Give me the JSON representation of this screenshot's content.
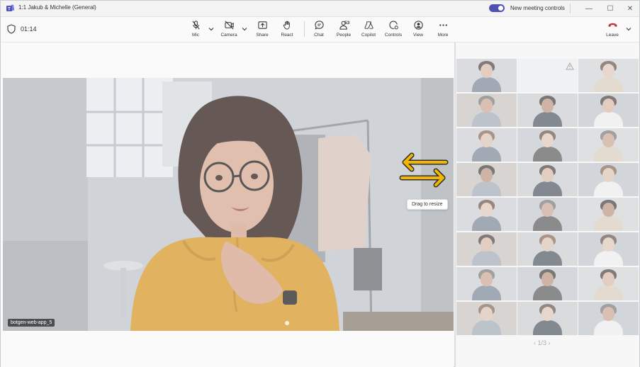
{
  "window": {
    "title": "1:1 Jakub & Michelle (General)",
    "new_meeting_controls_label": "New meeting controls",
    "new_meeting_controls_on": true,
    "minimize": "—",
    "maximize": "☐",
    "close": "✕"
  },
  "toolbar": {
    "timer": "01:14",
    "mic": "Mic",
    "camera": "Camera",
    "share": "Share",
    "react": "React",
    "chat": "Chat",
    "people": "People",
    "people_count": "53",
    "copilot": "Copilot",
    "controls": "Controls",
    "view": "View",
    "more": "More",
    "leave": "Leave"
  },
  "stage": {
    "participant_name": "botgen-web-app_5"
  },
  "gallery": {
    "pager": "1/3"
  },
  "overlay": {
    "tooltip": "Drag to resize",
    "arrow_color": "#f2b800"
  },
  "colors": {
    "accent": "#4f52b2",
    "leave": "#c4314b"
  }
}
